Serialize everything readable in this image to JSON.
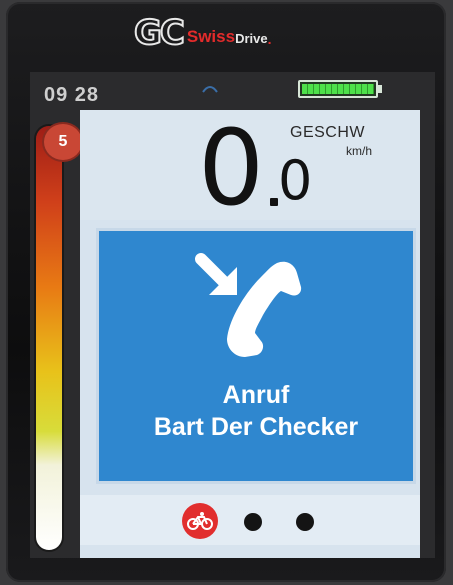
{
  "brand": {
    "gc": "GC",
    "swiss": "Swiss",
    "drive": "Drive",
    "dot": "."
  },
  "status": {
    "time": "09 28",
    "battery_level": 1.0,
    "battery_color": "#4ee04a"
  },
  "assist": {
    "level": "5",
    "badge_color": "#c94735"
  },
  "speed": {
    "integer": "0",
    "decimal": "0",
    "label": "GESCHW",
    "unit": "km/h"
  },
  "call": {
    "title": "Anruf",
    "caller": "Bart Der Checker",
    "icon": "incoming-call-icon",
    "accent": "#2f87cf"
  },
  "pages": {
    "active_icon": "bike-icon",
    "active_color": "#e12e2e",
    "count": 3
  }
}
